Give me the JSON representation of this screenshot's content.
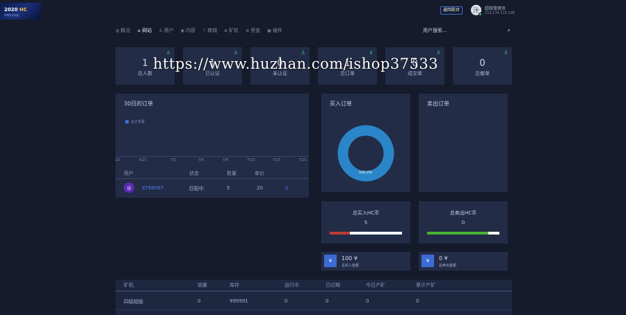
{
  "header": {
    "logo_year": "2020",
    "logo_mark": "HC",
    "logo_sub": "中国节点大会",
    "back_button": "返回前台",
    "user_name": "超级管理员",
    "user_ip": "219.134.115.198"
  },
  "nav": [
    {
      "icon": "◍",
      "label": "概况",
      "active": false
    },
    {
      "icon": "≡",
      "label": "网站",
      "active": true
    },
    {
      "icon": "♙",
      "label": "用户",
      "active": false
    },
    {
      "icon": "◉",
      "label": "内容",
      "active": false
    },
    {
      "icon": "⊤",
      "label": "商城",
      "active": false
    },
    {
      "icon": "⊕",
      "label": "矿机",
      "active": false
    },
    {
      "icon": "⊛",
      "label": "资金",
      "active": false
    },
    {
      "icon": "▣",
      "label": "插件",
      "active": false
    }
  ],
  "search": {
    "placeholder": "用户搜索..."
  },
  "stats": [
    {
      "icon": "user",
      "value": "1",
      "label": "总人数"
    },
    {
      "icon": "user",
      "value": "1",
      "label": "已认证"
    },
    {
      "icon": "user",
      "value": "0",
      "label": "未认证"
    },
    {
      "icon": "cart",
      "value": "1",
      "label": "总订单"
    },
    {
      "icon": "cart",
      "value": "0",
      "label": "成交单"
    },
    {
      "icon": "cart",
      "value": "0",
      "label": "总撤单"
    }
  ],
  "watermark": "https://www.huzhan.com/ishop37533",
  "orders_chart": {
    "title": "30日的订单",
    "legend": "总订单量",
    "ticks": [
      "22",
      "6/27",
      "7/1",
      "7/5",
      "7/9",
      "7/13",
      "7/17",
      "7/21"
    ],
    "headers": [
      "用户",
      "状态",
      "数量",
      "单价"
    ],
    "rows": [
      {
        "user": "XT66067",
        "status": "匹配中",
        "qty": "5",
        "price": "20",
        "action": "2"
      }
    ]
  },
  "buy_orders": {
    "title": "买入订单",
    "percent_label": "100.0%",
    "percent": 100,
    "color": "#2a86c9"
  },
  "sell_orders": {
    "title": "卖出订单"
  },
  "buy_total": {
    "title": "总买入HC币",
    "value": "5",
    "fill": 0.28,
    "fill_color": "#c03a3a"
  },
  "sell_total": {
    "title": "总卖出HC币",
    "value": "0",
    "fill": 0.85,
    "fill_color": "#47b332"
  },
  "buy_amount": {
    "icon": "¥",
    "value": "100 ¥",
    "label": "总买入金额"
  },
  "sell_amount": {
    "icon": "¥",
    "value": "0 ¥",
    "label": "总卖出金额"
  },
  "miners": {
    "headers": [
      "矿机",
      "销量",
      "库存",
      "运行中",
      "已过期",
      "今日产矿",
      "累计产矿"
    ],
    "rows": [
      [
        "四级超级",
        "0",
        "999991",
        "0",
        "0",
        "0",
        "0"
      ]
    ]
  }
}
